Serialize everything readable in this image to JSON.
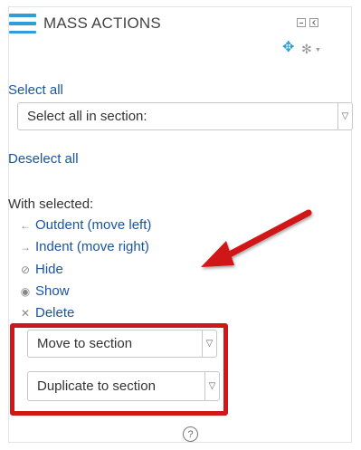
{
  "block": {
    "title": "MASS ACTIONS",
    "icons": {
      "menu": "hamburger-icon",
      "minimize": "minimize-icon",
      "dock": "dock-icon",
      "move": "move-icon",
      "settings": "gear-icon"
    }
  },
  "select_all": {
    "label": "Select all"
  },
  "section_select": {
    "value": "Select all in section:"
  },
  "deselect_all": {
    "label": "Deselect all"
  },
  "with_selected": {
    "label": "With selected:"
  },
  "actions": [
    {
      "label": "Outdent (move left)",
      "icon": "arrow-left-icon",
      "glyph": "←"
    },
    {
      "label": "Indent (move right)",
      "icon": "arrow-right-icon",
      "glyph": "→"
    },
    {
      "label": "Hide",
      "icon": "eye-slash-icon",
      "glyph": "⊘"
    },
    {
      "label": "Show",
      "icon": "eye-icon",
      "glyph": "◉"
    },
    {
      "label": "Delete",
      "icon": "x-icon",
      "glyph": "✕"
    }
  ],
  "move_to_section": {
    "value": "Move to section"
  },
  "duplicate_to_section": {
    "value": "Duplicate to section"
  },
  "annotation": {
    "color": "#d01717"
  },
  "colors": {
    "accent": "#2f9ed8",
    "link": "#1a55a3"
  }
}
